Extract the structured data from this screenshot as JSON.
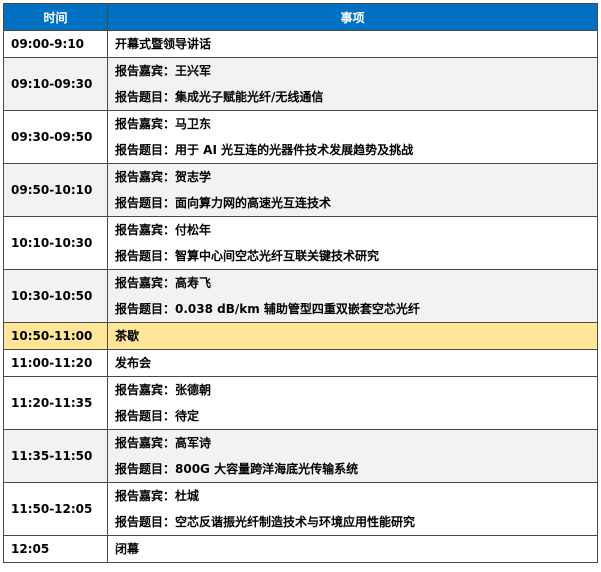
{
  "header": {
    "time": "时间",
    "item": "事项"
  },
  "rows": [
    {
      "time": "09:00-9:10",
      "lines": [
        "开幕式暨领导讲话"
      ]
    },
    {
      "time": "09:10-09:30",
      "lines": [
        "报告嘉宾：王兴军",
        "报告题目：集成光子赋能光纤/无线通信"
      ]
    },
    {
      "time": "09:30-09:50",
      "lines": [
        "报告嘉宾：马卫东",
        "报告题目：用于 AI 光互连的光器件技术发展趋势及挑战"
      ]
    },
    {
      "time": "09:50-10:10",
      "lines": [
        "报告嘉宾：贺志学",
        "报告题目：面向算力网的高速光互连技术"
      ]
    },
    {
      "time": "10:10-10:30",
      "lines": [
        "报告嘉宾：付松年",
        "报告题目：智算中心间空芯光纤互联关键技术研究"
      ]
    },
    {
      "time": "10:30-10:50",
      "lines": [
        "报告嘉宾：高寿飞",
        "报告题目：0.038 dB/km 辅助管型四重双嵌套空芯光纤"
      ]
    },
    {
      "time": "10:50-11:00",
      "lines": [
        "茶歇"
      ]
    },
    {
      "time": "11:00-11:20",
      "lines": [
        "发布会"
      ]
    },
    {
      "time": "11:20-11:35",
      "lines": [
        "报告嘉宾：张德朝",
        "报告题目：待定"
      ]
    },
    {
      "time": "11:35-11:50",
      "lines": [
        "报告嘉宾：高军诗",
        "报告题目：800G 大容量跨洋海底光传输系统"
      ]
    },
    {
      "time": "11:50-12:05",
      "lines": [
        "报告嘉宾：杜城",
        "报告题目：空芯反谐振光纤制造技术与环境应用性能研究"
      ]
    },
    {
      "time": "12:05",
      "lines": [
        "闭幕"
      ]
    }
  ],
  "colors": {
    "header_bg": "#0070c0",
    "break_bg": "#ffe699",
    "alt_row_bg": "#f2f2f2"
  }
}
